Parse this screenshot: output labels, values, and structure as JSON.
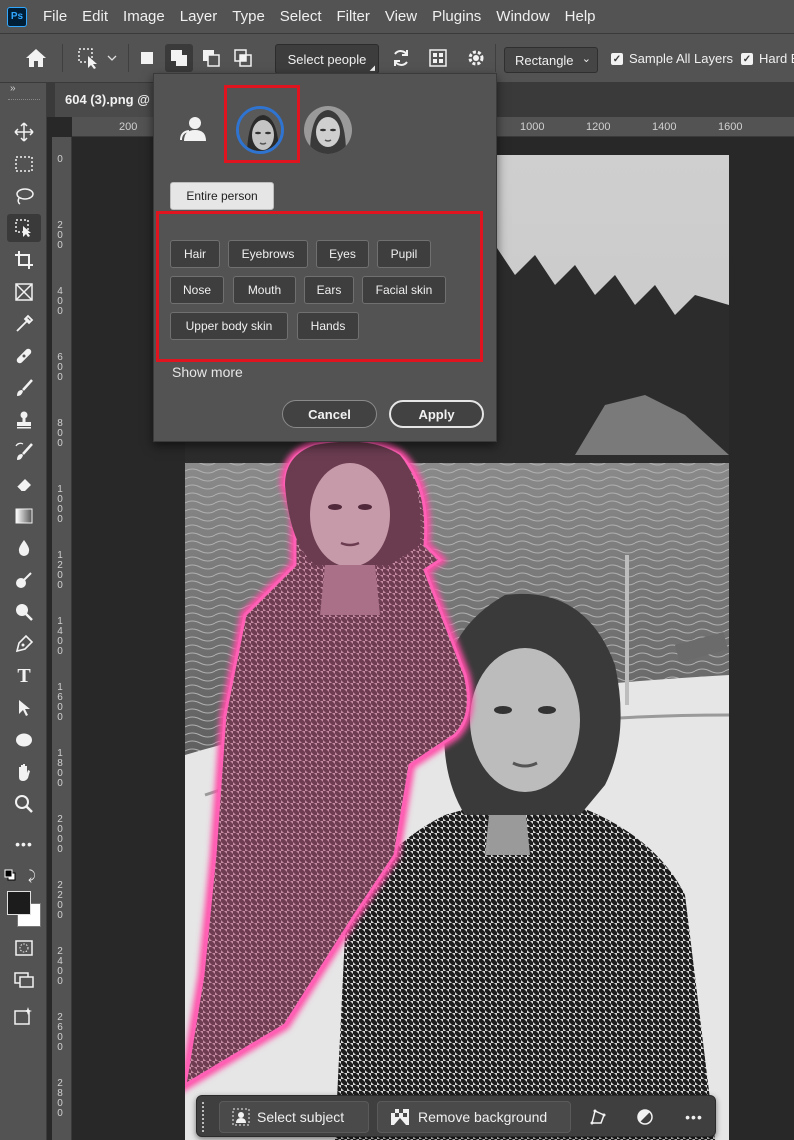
{
  "app": {
    "logo_text": "Ps"
  },
  "menu": [
    "File",
    "Edit",
    "Image",
    "Layer",
    "Type",
    "Select",
    "Filter",
    "View",
    "Plugins",
    "Window",
    "Help"
  ],
  "options_bar": {
    "select_people_label": "Select people",
    "mode_dropdown_value": "Rectangle",
    "sample_all_layers_label": "Sample All Layers",
    "hard_edge_label": "Hard E",
    "sample_all_layers_checked": true,
    "hard_edge_checked": true
  },
  "document": {
    "tab_title": "604 (3).png @"
  },
  "rulers": {
    "horizontal": [
      "200",
      "1000",
      "1200",
      "1400",
      "1600"
    ],
    "vertical": [
      "0",
      "200",
      "400",
      "600",
      "800",
      "1000",
      "1200",
      "1400",
      "1600",
      "1800",
      "2000",
      "2200",
      "2400",
      "2600",
      "2800"
    ]
  },
  "popup": {
    "entire_person_label": "Entire person",
    "parts": [
      [
        "Hair",
        "Eyebrows",
        "Eyes",
        "Pupil"
      ],
      [
        "Nose",
        "Mouth",
        "Ears",
        "Facial skin"
      ],
      [
        "Upper body skin",
        "Hands"
      ]
    ],
    "show_more_label": "Show more",
    "cancel_label": "Cancel",
    "apply_label": "Apply",
    "selected_person_index": 0
  },
  "taskbar": {
    "select_subject_label": "Select subject",
    "remove_background_label": "Remove background",
    "more_label": "•••"
  },
  "colors": {
    "accent_blue": "#2f74d0",
    "highlight_red": "#e0141e",
    "selection_pink": "#ff4fa8"
  }
}
